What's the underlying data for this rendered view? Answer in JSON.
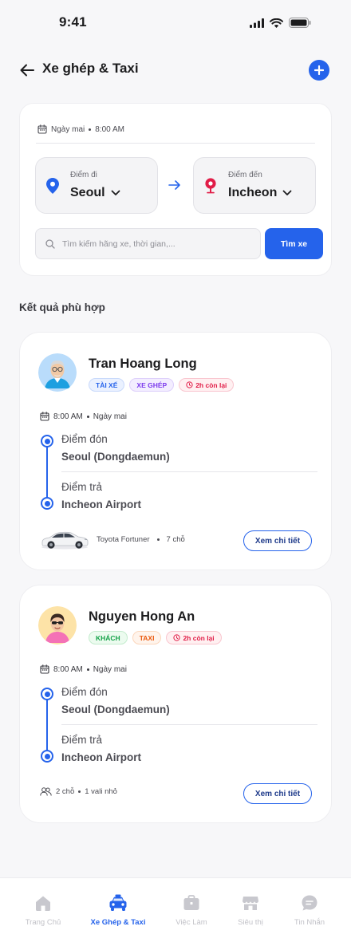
{
  "status_bar": {
    "time": "9:41"
  },
  "header": {
    "title": "Xe ghép & Taxi"
  },
  "search": {
    "date": "Ngày mai",
    "time": "8:00 AM",
    "from_label": "Điểm đi",
    "from_value": "Seoul",
    "to_label": "Điểm đến",
    "to_value": "Incheon",
    "placeholder": "Tìm kiếm hãng xe, thời gian,...",
    "button": "Tìm xe"
  },
  "results": {
    "title": "Kết quả phù hợp",
    "items": [
      {
        "name": "Tran Hoang Long",
        "tags": [
          "TÀI XẾ",
          "XE GHÉP",
          "2h còn lại"
        ],
        "time": "8:00 AM",
        "date": "Ngày mai",
        "pickup_label": "Điểm đón",
        "pickup": "Seoul (Dongdaemun)",
        "dropoff_label": "Điểm trả",
        "dropoff": "Incheon Airport",
        "vehicle": "Toyota Fortuner",
        "seats": "7 chỗ",
        "button": "Xem chi tiết"
      },
      {
        "name": "Nguyen Hong An",
        "tags": [
          "KHÁCH",
          "TAXI",
          "2h còn lại"
        ],
        "time": "8:00 AM",
        "date": "Ngày mai",
        "pickup_label": "Điểm đón",
        "pickup": "Seoul (Dongdaemun)",
        "dropoff_label": "Điểm trả",
        "dropoff": "Incheon Airport",
        "passengers": "2 chỗ",
        "luggage": "1 vali nhỏ",
        "button": "Xem chi tiết"
      }
    ]
  },
  "nav": {
    "items": [
      {
        "label": "Trang Chủ",
        "icon": "home-icon"
      },
      {
        "label": "Xe Ghép & Taxi",
        "icon": "taxi-icon",
        "active": true
      },
      {
        "label": "Việc Làm",
        "icon": "briefcase-icon"
      },
      {
        "label": "Siêu thị",
        "icon": "store-icon"
      },
      {
        "label": "Tin Nhắn",
        "icon": "chat-icon"
      }
    ]
  },
  "colors": {
    "accent": "#2563eb",
    "pin_from": "#2563eb",
    "pin_to": "#e11d48"
  }
}
